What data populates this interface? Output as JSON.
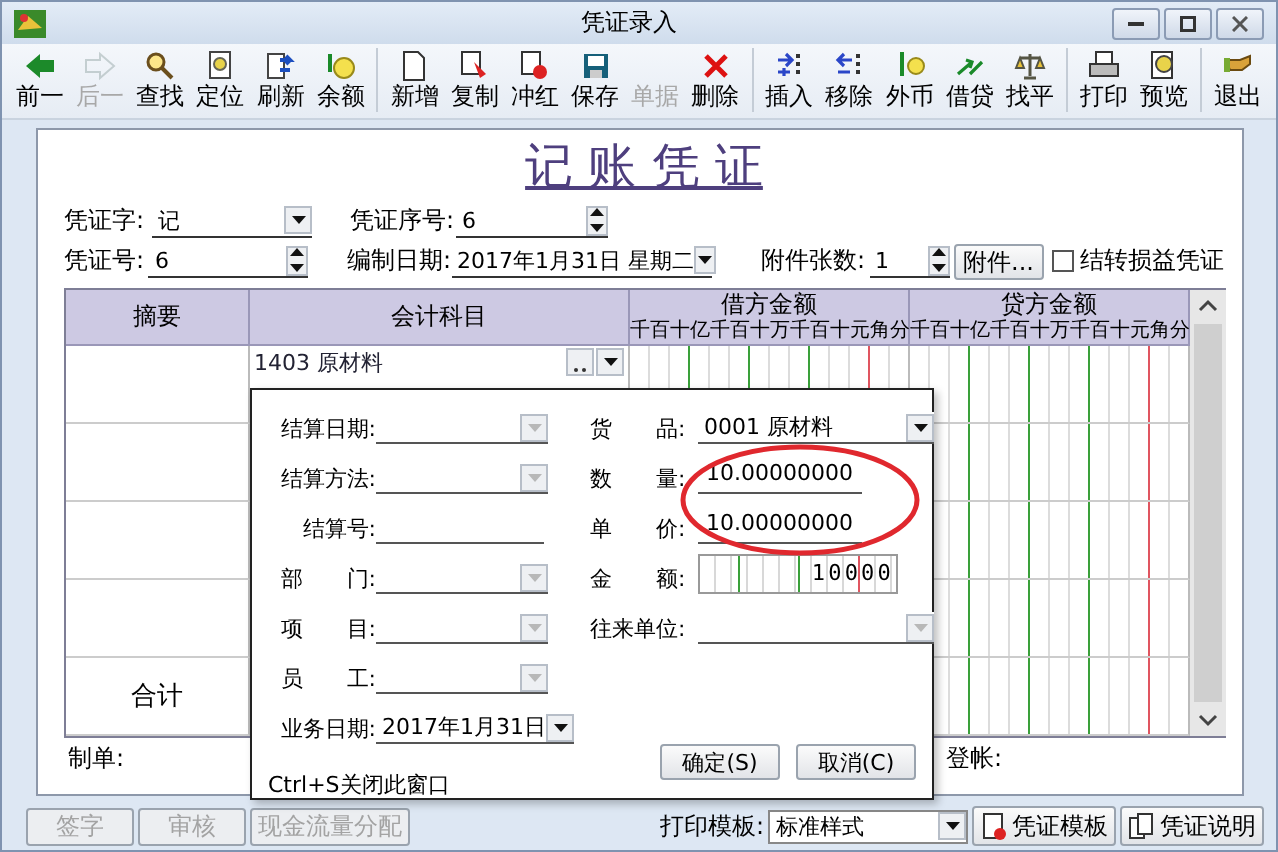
{
  "window": {
    "title": "凭证录入"
  },
  "toolbar": [
    [
      {
        "label": "前一",
        "disabled": false
      },
      {
        "label": "后一",
        "disabled": true
      },
      {
        "label": "查找",
        "disabled": false
      },
      {
        "label": "定位",
        "disabled": false
      },
      {
        "label": "刷新",
        "disabled": false
      },
      {
        "label": "余额",
        "disabled": false
      }
    ],
    [
      {
        "label": "新增",
        "disabled": false
      },
      {
        "label": "复制",
        "disabled": false
      },
      {
        "label": "冲红",
        "disabled": false
      },
      {
        "label": "保存",
        "disabled": false
      },
      {
        "label": "单据",
        "disabled": true
      },
      {
        "label": "删除",
        "disabled": false
      }
    ],
    [
      {
        "label": "插入",
        "disabled": false
      },
      {
        "label": "移除",
        "disabled": false
      },
      {
        "label": "外币",
        "disabled": false
      },
      {
        "label": "借贷",
        "disabled": false
      },
      {
        "label": "找平",
        "disabled": false
      }
    ],
    [
      {
        "label": "打印",
        "disabled": false
      },
      {
        "label": "预览",
        "disabled": false
      }
    ],
    [
      {
        "label": "退出",
        "disabled": false
      }
    ]
  ],
  "voucher": {
    "heading": "记 账 凭 证",
    "type": {
      "label": "凭证字:",
      "value": "记"
    },
    "sequence": {
      "label": "凭证序号:",
      "value": "6"
    },
    "number": {
      "label": "凭证号:",
      "value": "6"
    },
    "date": {
      "label": "编制日期:",
      "value": "2017年1月31日 星期二"
    },
    "attachments": {
      "label": "附件张数:",
      "value": "1",
      "button": "附件..."
    },
    "profit_loss_transfer": {
      "label": "结转损益凭证",
      "checked": false
    }
  },
  "table": {
    "columns": [
      {
        "label": "摘要"
      },
      {
        "label": "会计科目"
      },
      {
        "label": "借方金额",
        "units": [
          "千",
          "百",
          "十",
          "亿",
          "千",
          "百",
          "十",
          "万",
          "千",
          "百",
          "十",
          "元",
          "角",
          "分"
        ]
      },
      {
        "label": "贷方金额",
        "units": [
          "千",
          "百",
          "十",
          "亿",
          "千",
          "百",
          "十",
          "万",
          "千",
          "百",
          "十",
          "元",
          "角",
          "分"
        ]
      }
    ],
    "rows": [
      {
        "account": "1403 原材料"
      },
      {},
      {},
      {}
    ],
    "total_label": "合计"
  },
  "signatures": {
    "maker": "制单:",
    "poster": "登帐:"
  },
  "bottom_bar": {
    "buttons": [
      {
        "label": "签字",
        "disabled": true
      },
      {
        "label": "审核",
        "disabled": true
      },
      {
        "label": "现金流量分配",
        "disabled": true
      }
    ],
    "print_template": {
      "label": "打印模板:",
      "value": "标准样式"
    },
    "tools": [
      {
        "label": "凭证模板"
      },
      {
        "label": "凭证说明"
      }
    ]
  },
  "dialog": {
    "left_fields": [
      {
        "label": "结算日期:",
        "kind": "combo",
        "disabled": true
      },
      {
        "label": "结算方法:",
        "kind": "combo",
        "disabled": true
      },
      {
        "label": "结算号:",
        "kind": "text"
      },
      {
        "label": "部　　门:",
        "kind": "combo",
        "disabled": true
      },
      {
        "label": "项　　目:",
        "kind": "combo",
        "disabled": true
      },
      {
        "label": "员　　工:",
        "kind": "combo",
        "disabled": true
      },
      {
        "label": "业务日期:",
        "kind": "combo",
        "disabled": false,
        "value": "2017年1月31日"
      }
    ],
    "right_fields": [
      {
        "label": "货　　品:",
        "kind": "combo",
        "disabled": false,
        "value": "0001 原材料"
      },
      {
        "label": "数　　量:",
        "kind": "text",
        "value": "10.00000000"
      },
      {
        "label": "单　　价:",
        "kind": "text",
        "value": "10.00000000"
      },
      {
        "label": "金　　额:",
        "kind": "amount",
        "value": "10000"
      },
      {
        "label": "往来单位:",
        "kind": "combo",
        "disabled": true
      }
    ],
    "hint": "Ctrl+S关闭此窗口",
    "buttons": [
      "确定(S)",
      "取消(C)"
    ]
  }
}
